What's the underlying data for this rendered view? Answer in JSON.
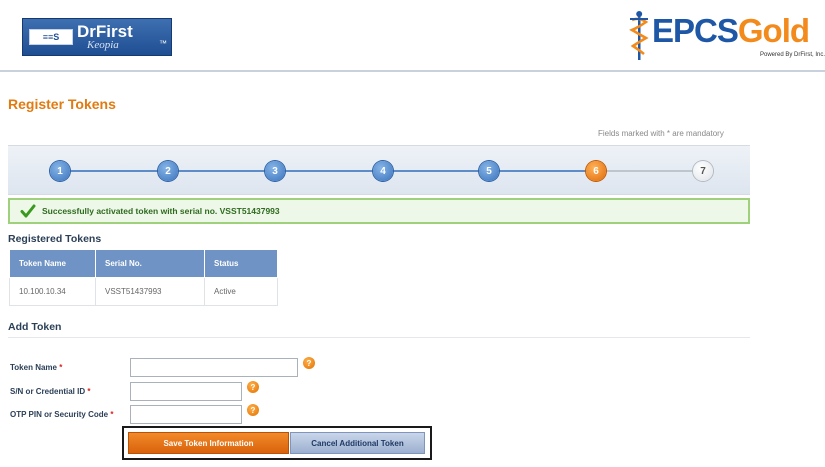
{
  "header": {
    "drfirst_badge": "≡≡S",
    "drfirst_name": "DrFirst",
    "drfirst_sub": "Keopia",
    "epcs_part1": "EPCS",
    "epcs_part2": "Gold",
    "epcs_powered": "Powered By DrFirst, Inc.",
    "colors": {
      "brand_blue": "#1d57a6",
      "brand_orange": "#f28a1c"
    }
  },
  "page": {
    "title": "Register Tokens",
    "mandatory_note": "Fields marked with * are mandatory"
  },
  "steps": [
    "1",
    "2",
    "3",
    "4",
    "5",
    "6",
    "7"
  ],
  "active_step": "6",
  "success": {
    "message": "Successfully activated token with serial no. VSST51437993",
    "icon": "check-icon"
  },
  "registered_tokens": {
    "heading": "Registered Tokens",
    "columns": [
      "Token Name",
      "Serial No.",
      "Status"
    ],
    "rows": [
      [
        "10.100.10.34",
        "VSST51437993",
        "Active"
      ]
    ]
  },
  "add_token": {
    "heading": "Add Token",
    "fields": [
      {
        "label": "Token Name",
        "required_mark": "*",
        "value": ""
      },
      {
        "label": "S/N or Credential ID",
        "required_mark": "*",
        "value": ""
      },
      {
        "label": "OTP PIN or Security Code",
        "required_mark": "*",
        "value": ""
      }
    ],
    "help_glyph": "?",
    "save_label": "Save Token Information",
    "cancel_label": "Cancel Additional Token"
  }
}
